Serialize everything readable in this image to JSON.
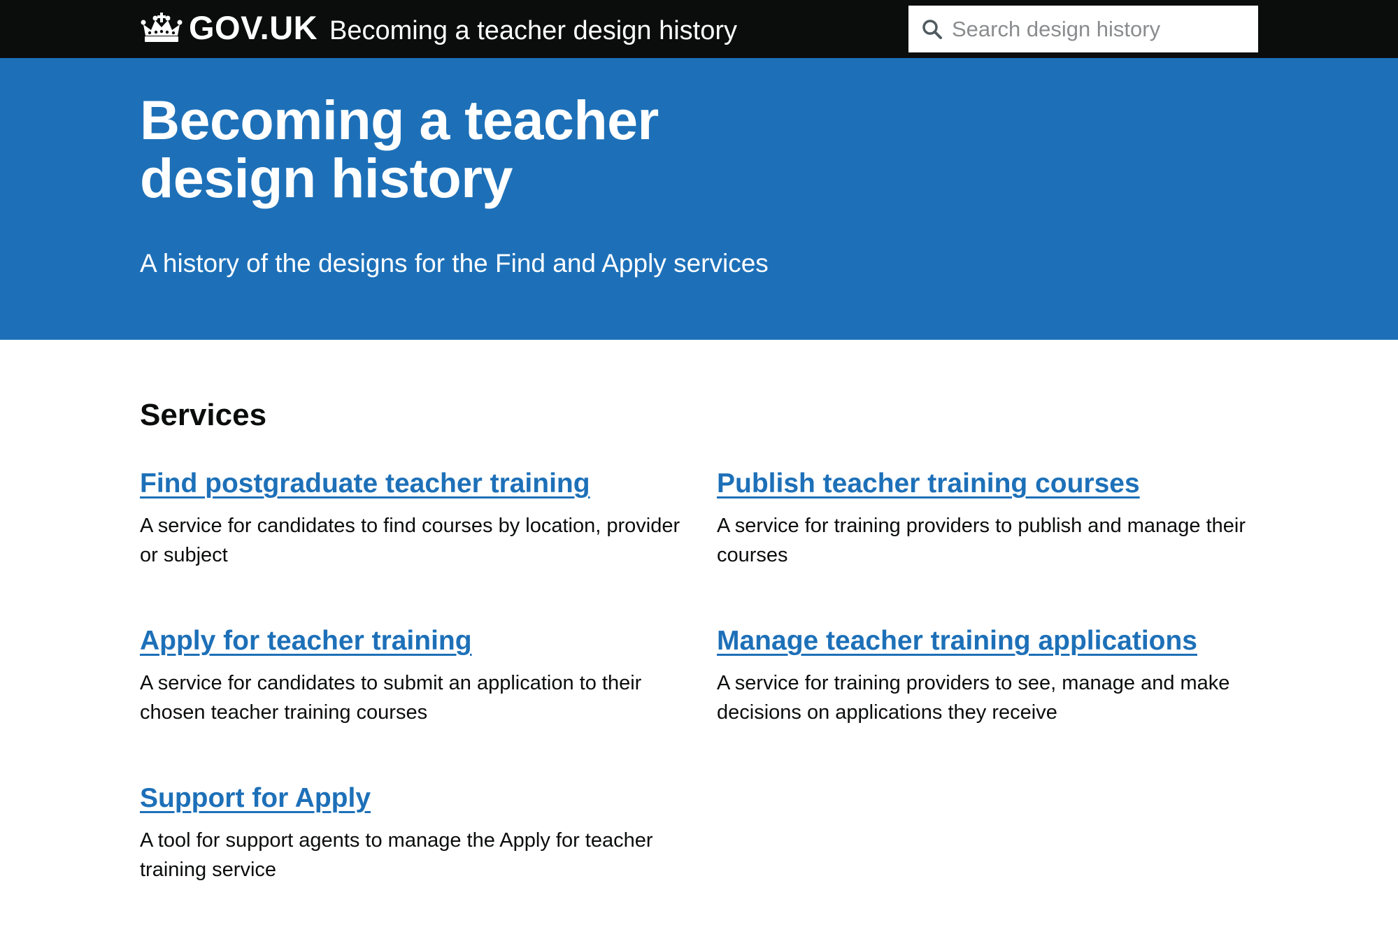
{
  "header": {
    "logo_text": "GOV.UK",
    "service_name": "Becoming a teacher design history",
    "search": {
      "placeholder": "Search design history",
      "value": ""
    }
  },
  "hero": {
    "title": "Becoming a teacher design history",
    "subtitle": "A history of the designs for the Find and Apply services"
  },
  "services": {
    "heading": "Services",
    "items": [
      {
        "title": "Find postgraduate teacher training",
        "description": "A service for candidates to find courses by location, provider or subject"
      },
      {
        "title": "Publish teacher training courses",
        "description": "A service for training providers to publish and manage their courses"
      },
      {
        "title": "Apply for teacher training",
        "description": "A service for candidates to submit an application to their chosen teacher training courses"
      },
      {
        "title": "Manage teacher training applications",
        "description": "A service for training providers to see, manage and make decisions on applications they receive"
      },
      {
        "title": "Support for Apply",
        "description": "A tool for support agents to manage the Apply for teacher training service"
      }
    ]
  },
  "colors": {
    "header_bg": "#0b0c0c",
    "hero_bg": "#1d70b8",
    "link": "#1d70b8",
    "text": "#0b0c0c"
  },
  "icons": {
    "logo": "crown-icon",
    "search": "search-icon"
  }
}
